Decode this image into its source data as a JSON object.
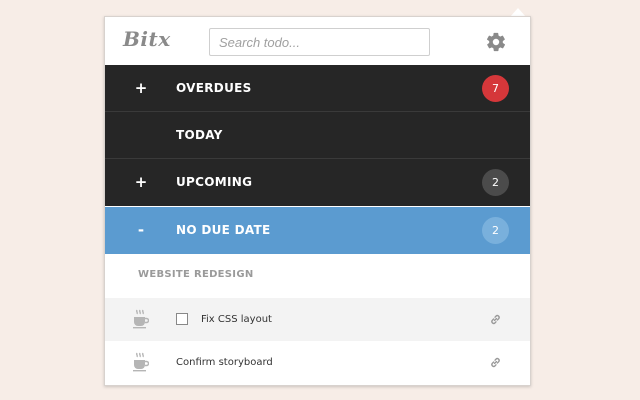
{
  "app": {
    "logo_text": "Bitx"
  },
  "search": {
    "placeholder": "Search todo..."
  },
  "icons": {
    "settings": "gear-icon",
    "expand": "plus-icon",
    "collapse": "minus-icon",
    "task_type": "coffee-cup-icon",
    "task_link": "link-icon"
  },
  "categories": [
    {
      "symbol": "+",
      "label": "OVERDUES",
      "count": "7"
    },
    {
      "symbol": "",
      "label": "TODAY",
      "count": ""
    },
    {
      "symbol": "+",
      "label": "UPCOMING",
      "count": "2"
    },
    {
      "symbol": "-",
      "label": "NO DUE DATE",
      "count": "2"
    }
  ],
  "group": {
    "title": "WEBSITE REDESIGN"
  },
  "tasks": [
    {
      "label": "Fix CSS layout",
      "has_checkbox": true,
      "checked": false
    },
    {
      "label": "Confirm storyboard",
      "has_checkbox": false,
      "checked": false
    }
  ],
  "colors": {
    "background": "#f7ede7",
    "dark_row": "#262626",
    "active_row": "#5b9bd0",
    "badge_red": "#d5373a",
    "badge_dark": "#4b4b4b",
    "badge_blue": "#79b0dc"
  }
}
